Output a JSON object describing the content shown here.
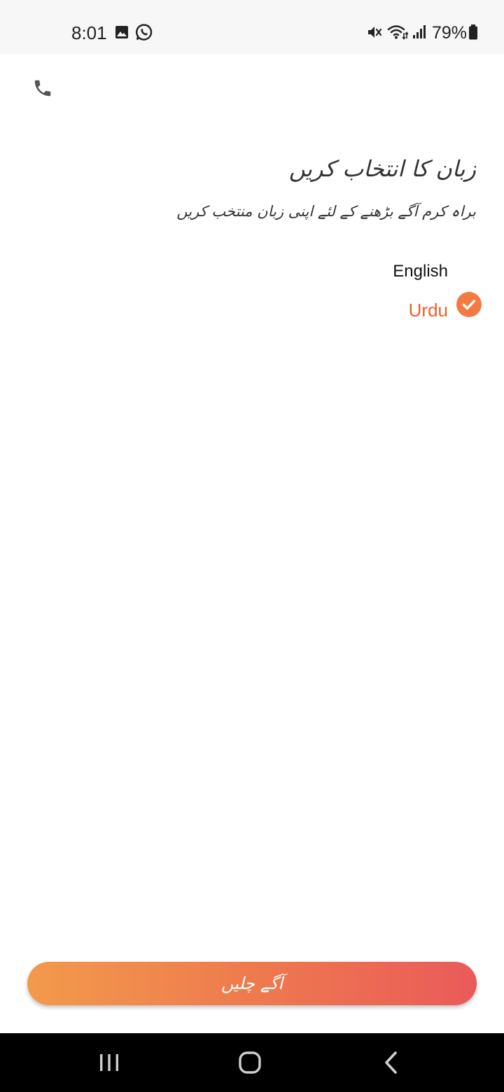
{
  "status_bar": {
    "time": "8:01",
    "battery_percent": "79%",
    "icons": [
      "gallery-icon",
      "whatsapp-icon",
      "mute-icon",
      "wifi-icon",
      "signal-icon",
      "battery-icon"
    ]
  },
  "header": {
    "call_icon": "phone-icon"
  },
  "language_screen": {
    "title": "زبان کا انتخاب کریں",
    "subtitle": "براہ کرم آگے بڑھنے کے لئے اپنی زبان منتخب کریں",
    "options": [
      {
        "label": "English",
        "selected": false
      },
      {
        "label": "Urdu",
        "selected": true
      }
    ],
    "selected_color": "#e8622c"
  },
  "footer": {
    "continue_label": "آگے چلیں",
    "gradient": [
      "#f29a4c",
      "#ea5a5a"
    ]
  },
  "nav_bar": {
    "buttons": [
      "recent-apps-icon",
      "home-icon",
      "back-icon"
    ]
  }
}
